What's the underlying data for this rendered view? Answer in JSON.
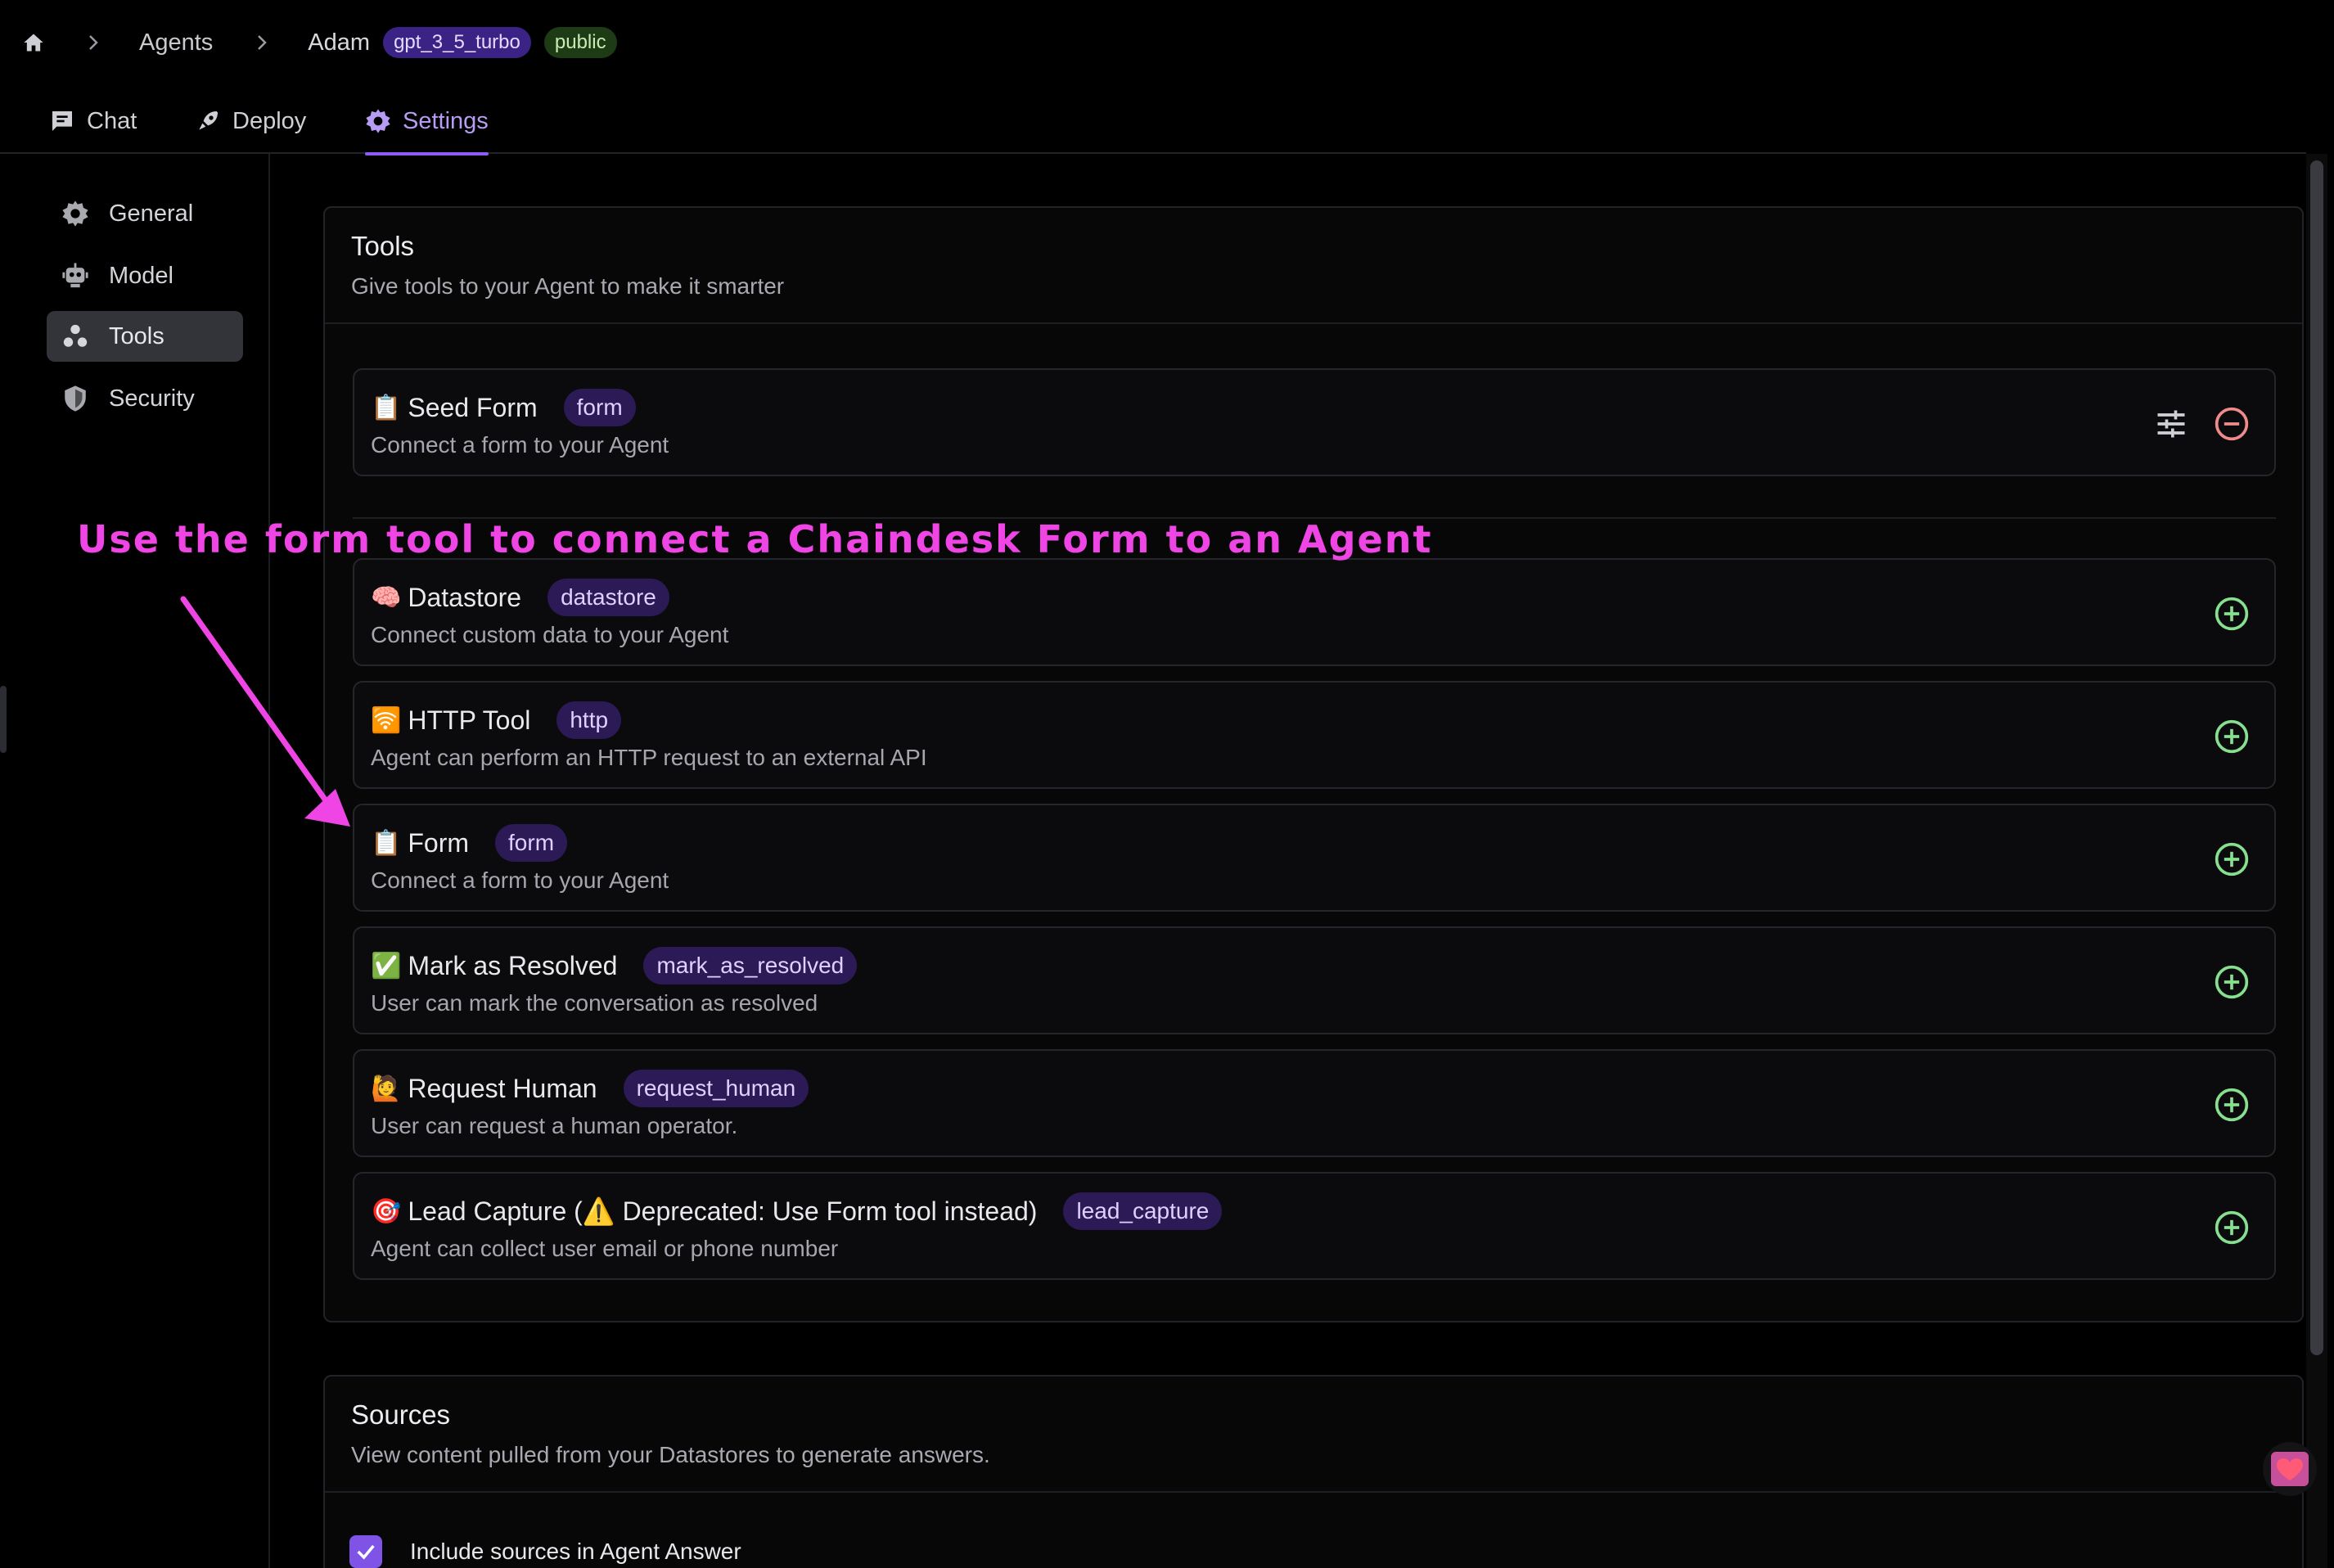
{
  "breadcrumb": {
    "items": [
      "Agents",
      "Adam"
    ],
    "badges": {
      "model": "gpt_3_5_turbo",
      "visibility": "public"
    }
  },
  "tabs": [
    {
      "label": "Chat",
      "icon": "chat-icon"
    },
    {
      "label": "Deploy",
      "icon": "rocket-icon"
    },
    {
      "label": "Settings",
      "icon": "gear-icon",
      "active": true
    }
  ],
  "sidebar": {
    "items": [
      {
        "label": "General",
        "icon": "gear-icon"
      },
      {
        "label": "Model",
        "icon": "robot-icon"
      },
      {
        "label": "Tools",
        "icon": "tools-icon",
        "active": true
      },
      {
        "label": "Security",
        "icon": "shield-icon"
      }
    ]
  },
  "tools_panel": {
    "title": "Tools",
    "subtitle": "Give tools to your Agent to make it smarter",
    "installed": [
      {
        "emoji": "📋",
        "name": "Seed Form",
        "tag": "form",
        "description": "Connect a form to your Agent"
      }
    ],
    "available": [
      {
        "emoji": "🧠",
        "name": "Datastore",
        "tag": "datastore",
        "description": "Connect custom data to your Agent"
      },
      {
        "emoji": "🛜",
        "name": "HTTP Tool",
        "tag": "http",
        "description": "Agent can perform an HTTP request to an external API"
      },
      {
        "emoji": "📋",
        "name": "Form",
        "tag": "form",
        "description": "Connect a form to your Agent"
      },
      {
        "emoji": "✅",
        "name": "Mark as Resolved",
        "tag": "mark_as_resolved",
        "description": "User can mark the conversation as resolved"
      },
      {
        "emoji": "🙋",
        "name": "Request Human",
        "tag": "request_human",
        "description": "User can request a human operator."
      },
      {
        "emoji": "🎯",
        "name": "Lead Capture (⚠️ Deprecated: Use Form tool instead)",
        "tag": "lead_capture",
        "description": "Agent can collect user email or phone number"
      }
    ]
  },
  "annotation": {
    "text": "Use the form tool to connect a Chaindesk Form to an Agent",
    "color": "#ef45e4"
  },
  "sources_panel": {
    "title": "Sources",
    "subtitle": "View content pulled from your Datastores to generate answers.",
    "checkbox_label": "Include sources in Agent Answer",
    "checked": true
  },
  "colors": {
    "accent": "#8b5cf6",
    "add_icon": "#86e08f",
    "remove_icon": "#f08b8b"
  }
}
